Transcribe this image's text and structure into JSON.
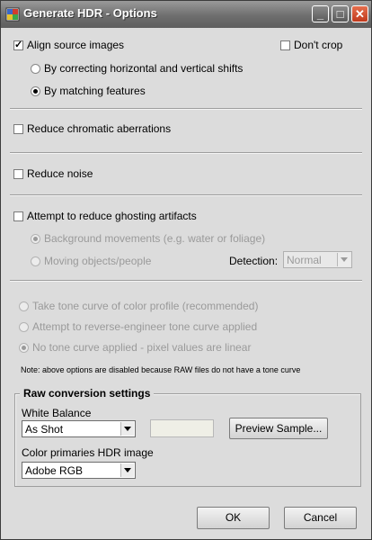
{
  "window": {
    "title": "Generate HDR - Options",
    "minimize_glyph": "_",
    "maximize_glyph": "□",
    "close_glyph": "✕"
  },
  "align": {
    "label": "Align source images",
    "checked": true,
    "dont_crop_label": "Don't crop",
    "options": [
      {
        "label": "By correcting horizontal and vertical shifts",
        "selected": false
      },
      {
        "label": "By matching features",
        "selected": true
      }
    ]
  },
  "chromatic": {
    "label": "Reduce chromatic aberrations",
    "checked": false
  },
  "noise": {
    "label": "Reduce noise",
    "checked": false
  },
  "ghosting": {
    "label": "Attempt to reduce ghosting artifacts",
    "checked": false,
    "options": [
      {
        "label": "Background movements (e.g. water or foliage)",
        "selected": true
      },
      {
        "label": "Moving objects/people",
        "selected": false
      }
    ],
    "detection_label": "Detection:",
    "detection_value": "Normal"
  },
  "tone_curve": {
    "options": [
      {
        "label": "Take tone curve of color profile (recommended)",
        "selected": false
      },
      {
        "label": "Attempt to reverse-engineer tone curve applied",
        "selected": false
      },
      {
        "label": "No tone curve applied - pixel values are linear",
        "selected": true
      }
    ],
    "note": "Note: above options are disabled because RAW files do not have a tone curve"
  },
  "raw": {
    "title": "Raw conversion settings",
    "white_balance_label": "White Balance",
    "white_balance_value": "As Shot",
    "preview_button": "Preview Sample...",
    "color_primaries_label": "Color primaries HDR image",
    "color_primaries_value": "Adobe RGB"
  },
  "buttons": {
    "ok": "OK",
    "cancel": "Cancel"
  },
  "colors": {
    "titlebar": "#6e6e6e",
    "close_button": "#c0391b",
    "background": "#dcdcdc",
    "disabled_text": "#9a9a9a"
  }
}
